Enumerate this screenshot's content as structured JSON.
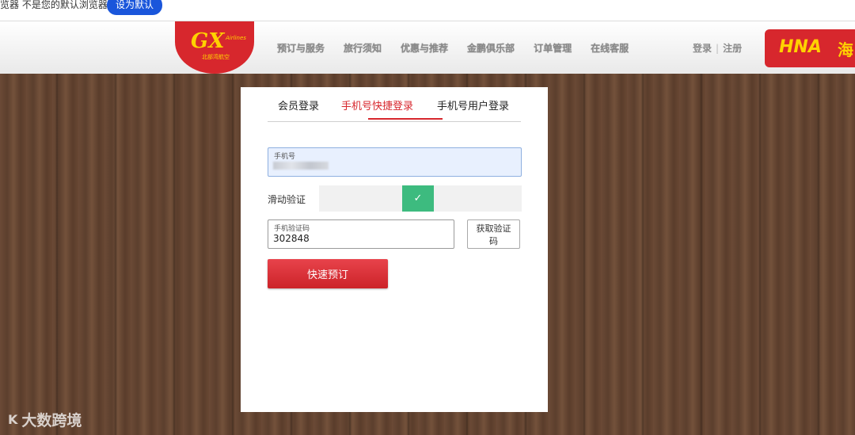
{
  "topbar": {
    "message": "览器 不是您的默认浏览器",
    "set_default_label": "设为默认"
  },
  "header": {
    "logo": {
      "mark": "GX",
      "script": "Airlines",
      "chinese": "北部湾航空"
    },
    "nav": [
      "预订与服务",
      "旅行须知",
      "优惠与推荐",
      "金鹏俱乐部",
      "订单管理",
      "在线客服"
    ],
    "login": "登录",
    "register": "注册",
    "partner": {
      "brand": "HNA",
      "chinese": "海"
    }
  },
  "login": {
    "tabs": [
      {
        "label": "会员登录",
        "active": false
      },
      {
        "label": "手机号快捷登录",
        "active": true
      },
      {
        "label": "手机号用户登录",
        "active": false
      }
    ],
    "phone": {
      "label": "手机号",
      "value": ""
    },
    "slider": {
      "label": "滑动验证",
      "hint": "过",
      "status": "verified"
    },
    "sms_code": {
      "label": "手机验证码",
      "value": "302848"
    },
    "get_code_label": "获取验证码",
    "submit_label": "快速预订"
  },
  "watermark": {
    "icon_text": "K",
    "text": "大数跨境"
  },
  "colors": {
    "brand_red": "#d7272d",
    "accent_blue": "#1a56db",
    "success_green": "#3dbb7f",
    "logo_yellow": "#ffd200"
  }
}
